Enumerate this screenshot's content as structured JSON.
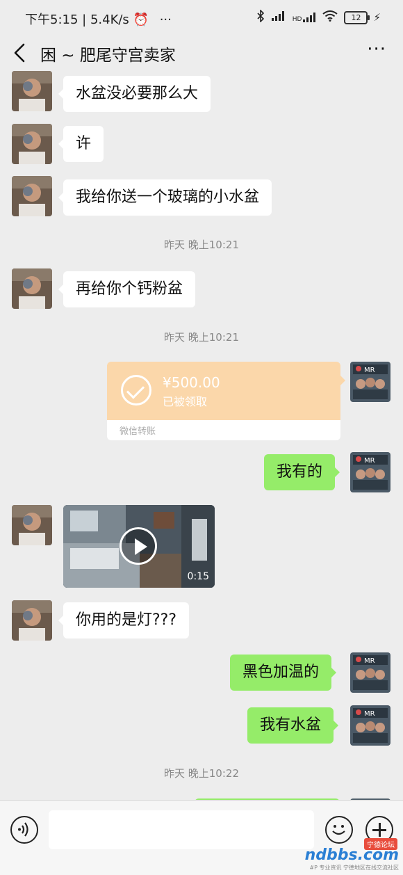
{
  "status_bar": {
    "time": "下午5:15",
    "speed": "5.4K/s",
    "network": "HD",
    "battery": "12"
  },
  "header": {
    "title": "困 ~ 肥尾守宫卖家"
  },
  "messages": {
    "m1": "水盆没必要那么大",
    "m2": "许",
    "m3": "我给你送一个玻璃的小水盆",
    "ts1": "昨天 晚上10:21",
    "m4": "再给你个钙粉盆",
    "ts2": "昨天 晚上10:21",
    "transfer": {
      "amount": "¥500.00",
      "status": "已被领取",
      "label": "微信转账"
    },
    "m5": "我有的",
    "video_duration": "0:15",
    "m6": "你用的是灯???",
    "m7": "黑色加温的",
    "m8": "我有水盆",
    "ts3": "昨天 晚上10:22"
  },
  "input": {
    "placeholder": ""
  },
  "watermark": {
    "brand": "ndbbs.com",
    "tag": "宁德论坛",
    "sub": "#P 专业资讯 宁德地区在线交流社区"
  },
  "colors": {
    "background": "#ededed",
    "outgoing_bubble": "#95ec69",
    "incoming_bubble": "#ffffff",
    "transfer_card": "#fbd7aa"
  }
}
